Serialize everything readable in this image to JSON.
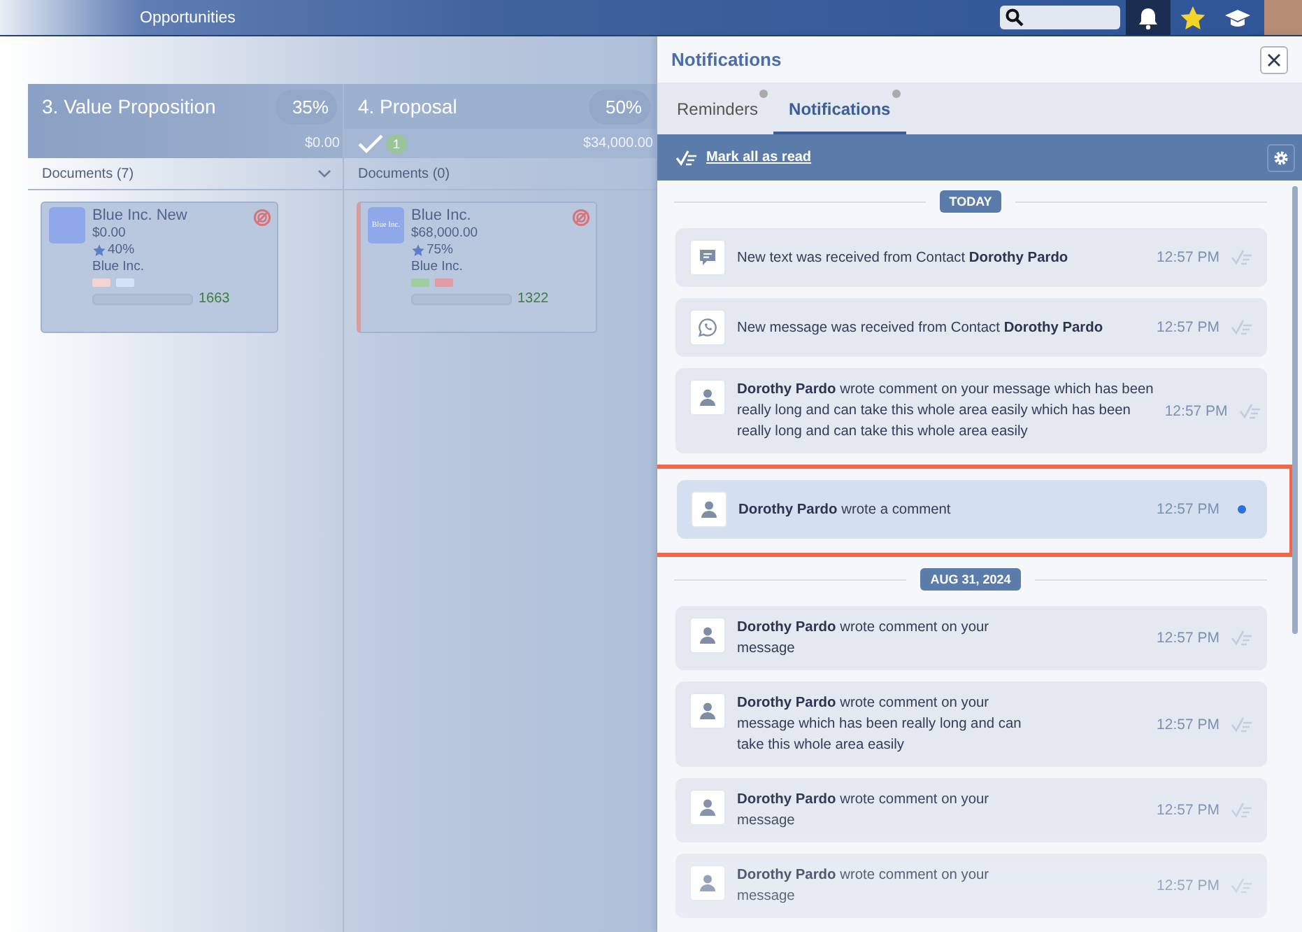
{
  "top_bar": {
    "title": "Opportunities",
    "icons": [
      {
        "kind": "bell",
        "selected": true
      },
      {
        "kind": "star",
        "selected": false
      },
      {
        "kind": "cap",
        "selected": false
      }
    ]
  },
  "board": {
    "columns": [
      {
        "title": "3. Value Proposition",
        "percent": "35%",
        "amount": "$0.00",
        "documents": "Documents (7)",
        "collapsible": true,
        "cards": [
          {
            "name": "Blue Inc. New",
            "amount": "$0.00",
            "probability": "40%",
            "company": "Blue Inc.",
            "number": "1663",
            "flagged": false,
            "tags": [
              {
                "color": "#f2d3d0"
              },
              {
                "color": "#d3e2f4"
              }
            ]
          }
        ]
      },
      {
        "title": "4. Proposal",
        "percent": "50%",
        "approved_count": "1",
        "amount": "$34,000.00",
        "documents": "Documents (0)",
        "collapsible": false,
        "cards": [
          {
            "logo_text": "Blue Inc.",
            "name": "Blue Inc.",
            "amount": "$68,000.00",
            "probability": "75%",
            "company": "Blue Inc.",
            "number": "1322",
            "flagged": true,
            "tags": [
              {
                "color": "#9fcf9f"
              },
              {
                "color": "#e29aa4"
              }
            ]
          }
        ]
      }
    ]
  },
  "panel": {
    "title": "Notifications",
    "tabs": [
      {
        "label": "Reminders",
        "selected": false,
        "dot": true
      },
      {
        "label": "Notifications",
        "selected": true,
        "dot": true
      }
    ],
    "mark_all": "Mark all as read",
    "groups": [
      {
        "date": "TODAY",
        "items": [
          {
            "kind": "sms",
            "lines": [
              "New text was received from Contact **Dorothy Pardo**"
            ],
            "time": "12:57 PM",
            "read": true,
            "highlighted": false
          },
          {
            "kind": "whatsapp",
            "lines": [
              "New message was received from Contact **Dorothy Pardo**"
            ],
            "time": "12:57 PM",
            "read": true,
            "highlighted": false
          },
          {
            "kind": "comment",
            "lines": [
              "**Dorothy Pardo** wrote comment on your message which has been",
              "really long and can take this whole area easily which has been",
              "really long and can take this whole area easily"
            ],
            "time": "12:57 PM",
            "read": true,
            "highlighted": false
          },
          {
            "kind": "comment",
            "lines": [
              "**Dorothy Pardo** wrote a comment"
            ],
            "time": "12:57 PM",
            "read": false,
            "highlighted": true
          }
        ]
      },
      {
        "date": "AUG 31, 2024",
        "items": [
          {
            "kind": "comment",
            "lines": [
              "**Dorothy Pardo** wrote comment on your",
              "message"
            ],
            "time": "12:57 PM",
            "read": true,
            "highlighted": false
          },
          {
            "kind": "comment",
            "lines": [
              "**Dorothy Pardo** wrote comment on your",
              "message which has been really long and can",
              "take this whole area easily"
            ],
            "time": "12:57 PM",
            "read": true,
            "highlighted": false
          },
          {
            "kind": "comment",
            "lines": [
              "**Dorothy Pardo** wrote comment on your",
              "message"
            ],
            "time": "12:57 PM",
            "read": true,
            "highlighted": false
          },
          {
            "kind": "comment",
            "lines": [
              "**Dorothy Pardo** wrote comment on your",
              "message"
            ],
            "time": "12:57 PM",
            "read": true,
            "highlighted": false
          }
        ]
      }
    ]
  }
}
